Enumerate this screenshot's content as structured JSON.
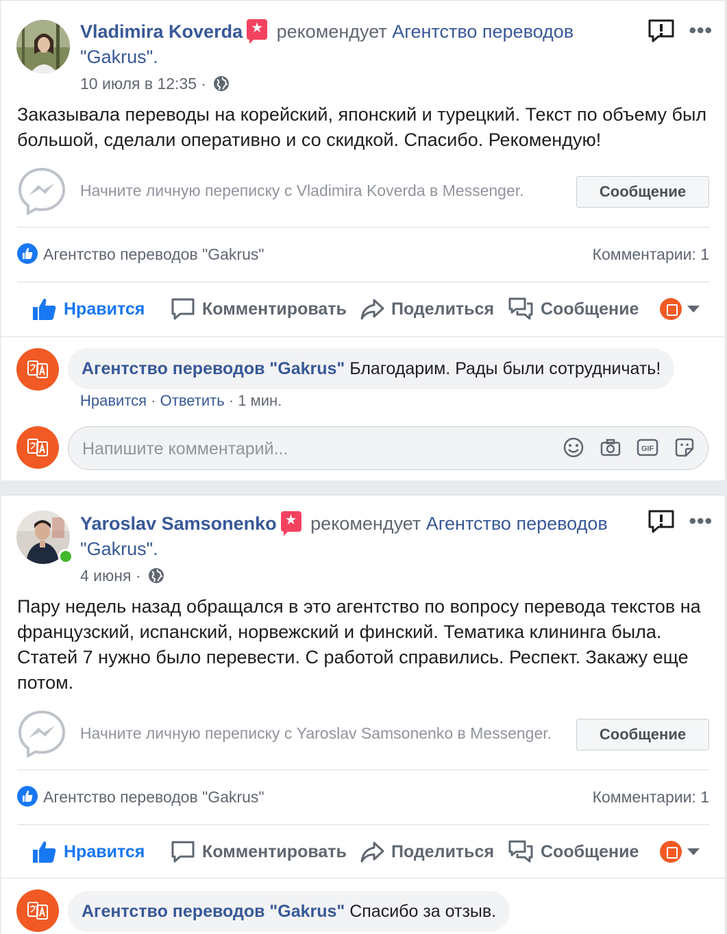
{
  "posts": [
    {
      "author": "Vladimira Koverda",
      "recommends_text": "рекомендует",
      "page_name_line1": "Агентство переводов",
      "page_name_line2": "\"Gakrus\".",
      "timestamp": "10 июля в 12:35 ·",
      "body": "Заказывала переводы на корейский, японский и турецкий. Текст по объему был большой, сделали оперативно и со скидкой. Спасибо. Рекомендую!",
      "messenger_prompt": "Начните личную переписку с Vladimira Koverda в Messenger.",
      "message_button": "Сообщение",
      "likes_by": "Агентство переводов \"Gakrus\"",
      "comments_count": "Комментарии: 1",
      "actions": {
        "like": "Нравится",
        "comment": "Комментировать",
        "share": "Поделиться",
        "message": "Сообщение"
      },
      "reply": {
        "author": "Агентство переводов \"Gakrus\"",
        "text": "Благодарим. Рады были сотрудничать!",
        "like_link": "Нравится",
        "reply_link": "Ответить",
        "time": "1 мин."
      },
      "comment_placeholder": "Напишите комментарий...",
      "online": false
    },
    {
      "author": "Yaroslav Samsonenko",
      "recommends_text": "рекомендует",
      "page_name_line1": "Агентство переводов",
      "page_name_line2": "\"Gakrus\".",
      "timestamp": "4 июня ·",
      "body": "Пару недель назад обращался в это агентство по вопросу перевода текстов на французский, испанский, норвежский и финский. Тематика клининга была. Статей 7 нужно было перевести. С работой справились. Респект. Закажу еще потом.",
      "messenger_prompt": "Начните личную переписку с Yaroslav Samsonenko в Messenger.",
      "message_button": "Сообщение",
      "likes_by": "Агентство переводов \"Gakrus\"",
      "comments_count": "Комментарии: 1",
      "actions": {
        "like": "Нравится",
        "comment": "Комментировать",
        "share": "Поделиться",
        "message": "Сообщение"
      },
      "reply": {
        "author": "Агентство переводов \"Gakrus\"",
        "text": "Спасибо за отзыв."
      },
      "online": true
    }
  ],
  "colors": {
    "link": "#385898",
    "like_blue": "#1877f2",
    "page_orange": "#f15a24",
    "recommend_badge": "#f3425f",
    "online_green": "#42b72a"
  }
}
